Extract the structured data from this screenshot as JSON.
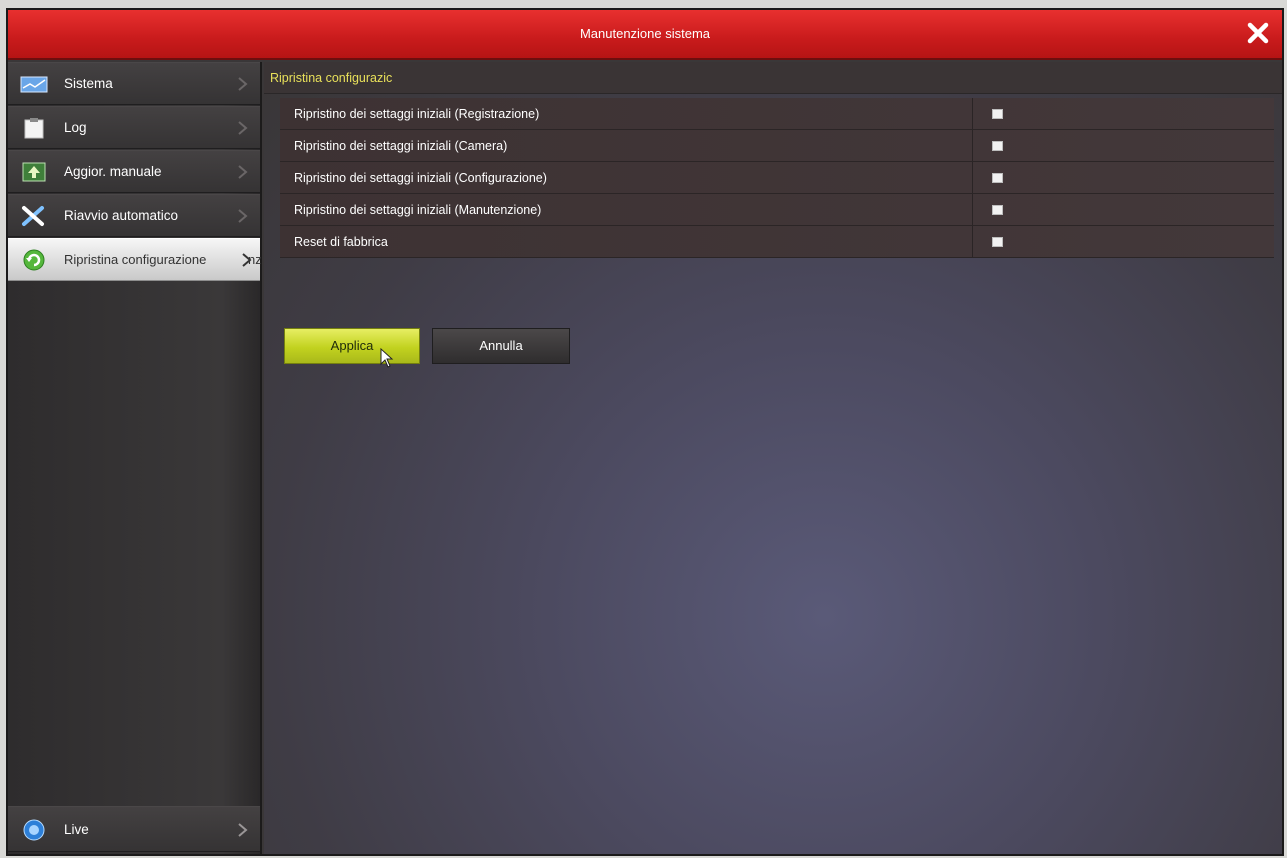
{
  "window": {
    "title": "Manutenzione sistema"
  },
  "sidebar": {
    "items": [
      {
        "label": "Sistema",
        "icon": "system-icon"
      },
      {
        "label": "Log",
        "icon": "log-icon"
      },
      {
        "label": "Aggior. manuale",
        "icon": "upgrade-icon"
      },
      {
        "label": "Riavvio automatico",
        "icon": "tools-icon"
      },
      {
        "label": "Ripristina configurazione",
        "overflow_text": "nz",
        "icon": "restore-icon",
        "active": true
      }
    ],
    "live": {
      "label": "Live",
      "icon": "live-icon"
    }
  },
  "main": {
    "section_title": "Ripristina configurazic",
    "options": [
      {
        "label": "Ripristino dei settaggi iniziali (Registrazione)",
        "checked": false
      },
      {
        "label": "Ripristino dei settaggi iniziali (Camera)",
        "checked": false
      },
      {
        "label": "Ripristino dei settaggi iniziali (Configurazione)",
        "checked": false
      },
      {
        "label": "Ripristino dei settaggi iniziali (Manutenzione)",
        "checked": false
      },
      {
        "label": "Reset di fabbrica",
        "checked": false
      }
    ],
    "apply_label": "Applica",
    "cancel_label": "Annulla"
  },
  "colors": {
    "title_bar": "#d42021",
    "section_title": "#e8e05a",
    "apply_button": "#c2d21f"
  }
}
